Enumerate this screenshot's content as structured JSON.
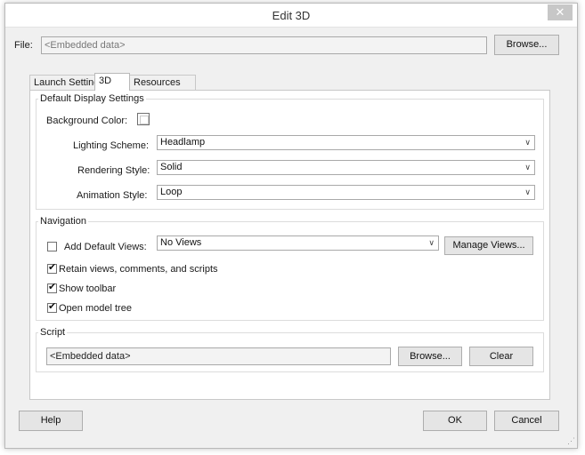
{
  "window": {
    "title": "Edit 3D",
    "close_symbol": "✕"
  },
  "file": {
    "label": "File:",
    "value": "<Embedded data>",
    "browse_label": "Browse..."
  },
  "tabs": [
    {
      "label": "Launch Settings",
      "active": false
    },
    {
      "label": "3D",
      "active": true
    },
    {
      "label": "Resources",
      "active": false
    }
  ],
  "display_settings": {
    "legend": "Default Display Settings",
    "background_color_label": "Background Color:",
    "background_color_value": "#ffffff",
    "lighting_label": "Lighting Scheme:",
    "lighting_value": "Headlamp",
    "rendering_label": "Rendering Style:",
    "rendering_value": "Solid",
    "animation_label": "Animation Style:",
    "animation_value": "Loop"
  },
  "navigation": {
    "legend": "Navigation",
    "add_default_views_label": "Add Default Views:",
    "add_default_views_checked": false,
    "views_value": "No Views",
    "manage_views_label": "Manage Views...",
    "retain_label": "Retain views, comments, and scripts",
    "retain_checked": true,
    "show_toolbar_label": "Show toolbar",
    "show_toolbar_checked": true,
    "open_tree_label": "Open model tree",
    "open_tree_checked": true
  },
  "script": {
    "legend": "Script",
    "value": "<Embedded data>",
    "browse_label": "Browse...",
    "clear_label": "Clear"
  },
  "footer": {
    "help_label": "Help",
    "ok_label": "OK",
    "cancel_label": "Cancel"
  },
  "icons": {
    "chevron": "chevron-down-icon",
    "check": "checkmark-icon",
    "close": "close-icon"
  }
}
